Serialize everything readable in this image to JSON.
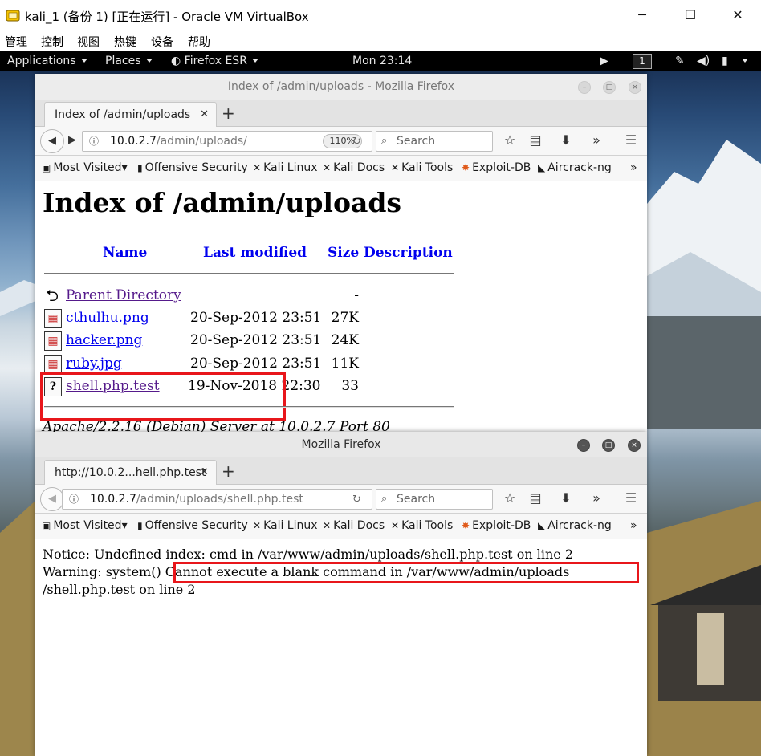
{
  "vbox": {
    "title": "kali_1 (备份 1) [正在运行] - Oracle VM VirtualBox",
    "minimize": "─",
    "maximize": "☐",
    "close": "✕",
    "menu": [
      "管理",
      "控制",
      "视图",
      "热键",
      "设备",
      "帮助"
    ]
  },
  "gnome": {
    "applications": "Applications",
    "places": "Places",
    "firefox": "Firefox ESR",
    "clock": "Mon 23:14",
    "workspace": "1",
    "icons": [
      "camera-icon",
      "screen-brush-icon",
      "volume-icon",
      "battery-icon",
      "system-menu-icon"
    ]
  },
  "window1": {
    "title": "Index of /admin/uploads - Mozilla Firefox",
    "tab_label": "Index of /admin/uploads",
    "url_host": "10.0.2.7",
    "url_path": "/admin/uploads/",
    "zoom": "110%",
    "search_placeholder": "Search"
  },
  "window2": {
    "title": "Mozilla Firefox",
    "tab_label": "http://10.0.2...hell.php.test",
    "url_host": "10.0.2.7",
    "url_path": "/admin/uploads/shell.php.test",
    "search_placeholder": "Search"
  },
  "bookmarks": [
    "Most Visited",
    "Offensive Security",
    "Kali Linux",
    "Kali Docs",
    "Kali Tools",
    "Exploit-DB",
    "Aircrack-ng"
  ],
  "bookmarks_overflow": "»",
  "index_page": {
    "heading": "Index of /admin/uploads",
    "columns": [
      "Name",
      "Last modified",
      "Size",
      "Description"
    ],
    "rows": [
      {
        "name": "Parent Directory",
        "date": "",
        "size": "-"
      },
      {
        "name": "cthulhu.png",
        "date": "20-Sep-2012 23:51",
        "size": "27K"
      },
      {
        "name": "hacker.png",
        "date": "20-Sep-2012 23:51",
        "size": "24K"
      },
      {
        "name": "ruby.jpg",
        "date": "20-Sep-2012 23:51",
        "size": "11K"
      },
      {
        "name": "shell.php.test",
        "date": "19-Nov-2018 22:30",
        "size": "33"
      }
    ],
    "address": "Apache/2.2.16 (Debian) Server at 10.0.2.7 Port 80"
  },
  "shell_page": {
    "line1": "Notice: Undefined index: cmd in /var/www/admin/uploads/shell.php.test on line 2",
    "line2_a": "Warning: system()",
    "line2_b": " Cannot execute a blank command in /var/www/admin/uploads",
    "line3": "/shell.php.test on line 2"
  },
  "colors": {
    "highlight_box": "#e8161b",
    "link": "#0000ee",
    "visited_link": "#551a8b"
  }
}
